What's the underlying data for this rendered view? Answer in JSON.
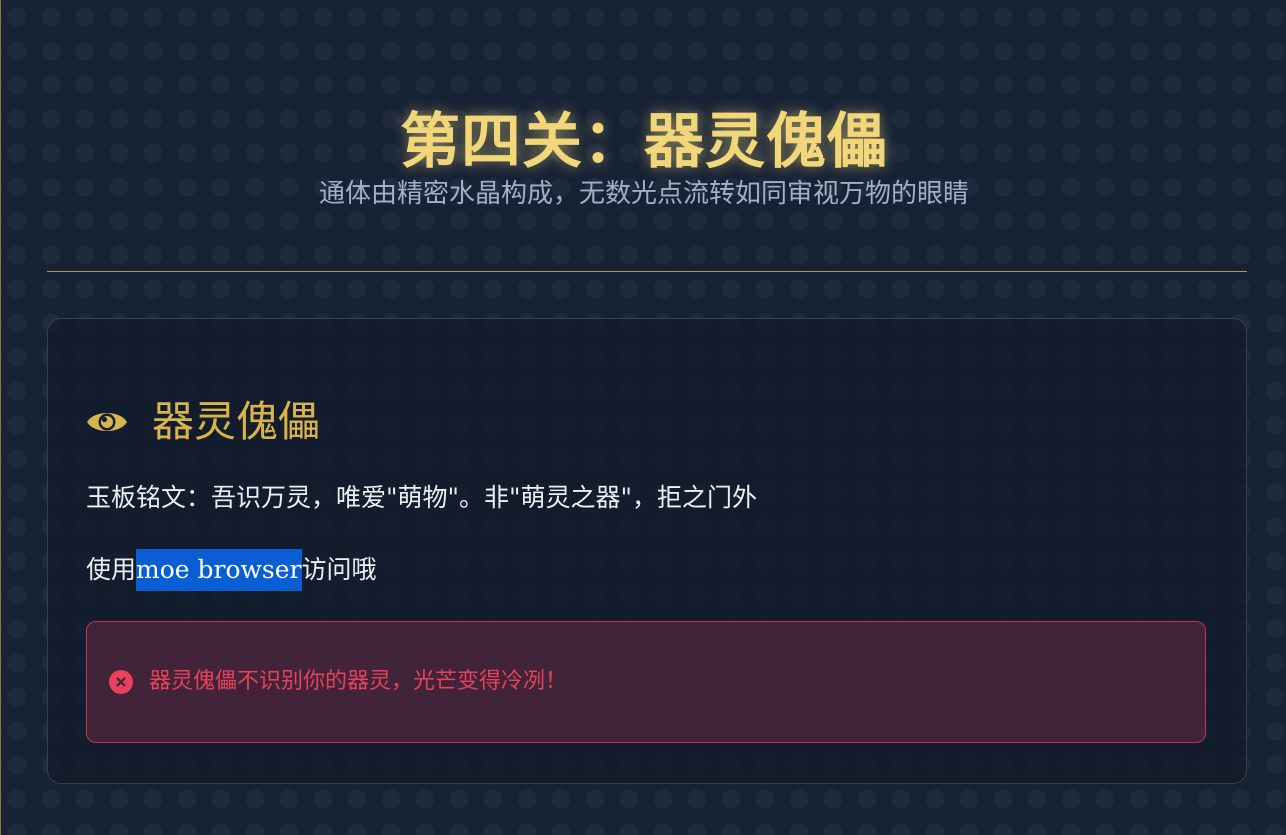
{
  "header": {
    "title": "第四关：器灵傀儡",
    "subtitle": "通体由精密水晶构成，无数光点流转如同审视万物的眼睛"
  },
  "card": {
    "icon": "eye-icon",
    "title": "器灵傀儡",
    "inscription": "玉板铭文：吾识万灵，唯爱\"萌物\"。非\"萌灵之器\"，拒之门外",
    "hint_prefix": "使用",
    "hint_highlight": "moe browser",
    "hint_suffix": "访问哦",
    "error": {
      "icon": "error-x-circle-icon",
      "message": "器灵傀儡不识别你的器灵，光芒变得冷冽！"
    }
  },
  "colors": {
    "background": "#172235",
    "title_gold": "#f1d77a",
    "accent_gold": "#d8b54a",
    "error_red": "#e8425a",
    "highlight_blue": "#0a5ed4"
  }
}
